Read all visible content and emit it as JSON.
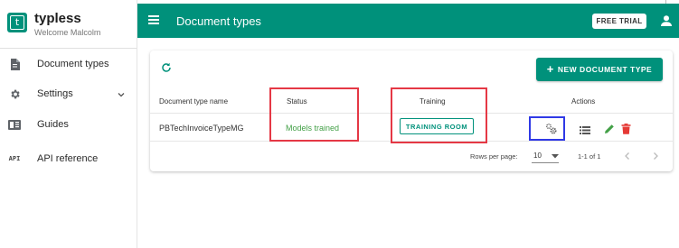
{
  "brand": {
    "name": "typless",
    "welcome": "Welcome Malcolm",
    "logo_letter": "t"
  },
  "sidebar": {
    "items": [
      {
        "label": "Document types",
        "icon": "document-icon"
      },
      {
        "label": "Settings",
        "icon": "gear-icon"
      },
      {
        "label": "Guides",
        "icon": "book-icon"
      },
      {
        "label": "API reference",
        "icon": "api-icon",
        "icon_text": "API"
      }
    ]
  },
  "topbar": {
    "title": "Document types",
    "trial_label": "FREE TRIAL"
  },
  "card": {
    "new_button_label": "NEW DOCUMENT TYPE",
    "new_button_plus": "+",
    "columns": [
      "Document type name",
      "Status",
      "Training",
      "Actions"
    ],
    "rows": [
      {
        "name": "PBTechInvoiceTypeMG",
        "status": "Models trained",
        "training_label": "TRAINING ROOM"
      }
    ],
    "pagination": {
      "rows_per_page_label": "Rows per page:",
      "rows_per_page": "10",
      "range": "1-1 of 1"
    }
  },
  "colors": {
    "brand": "#00917b",
    "status_ok": "#43a047",
    "edit": "#43a047",
    "delete": "#e53935",
    "highlight_red": "#e53845",
    "highlight_blue": "#2f39e6"
  }
}
